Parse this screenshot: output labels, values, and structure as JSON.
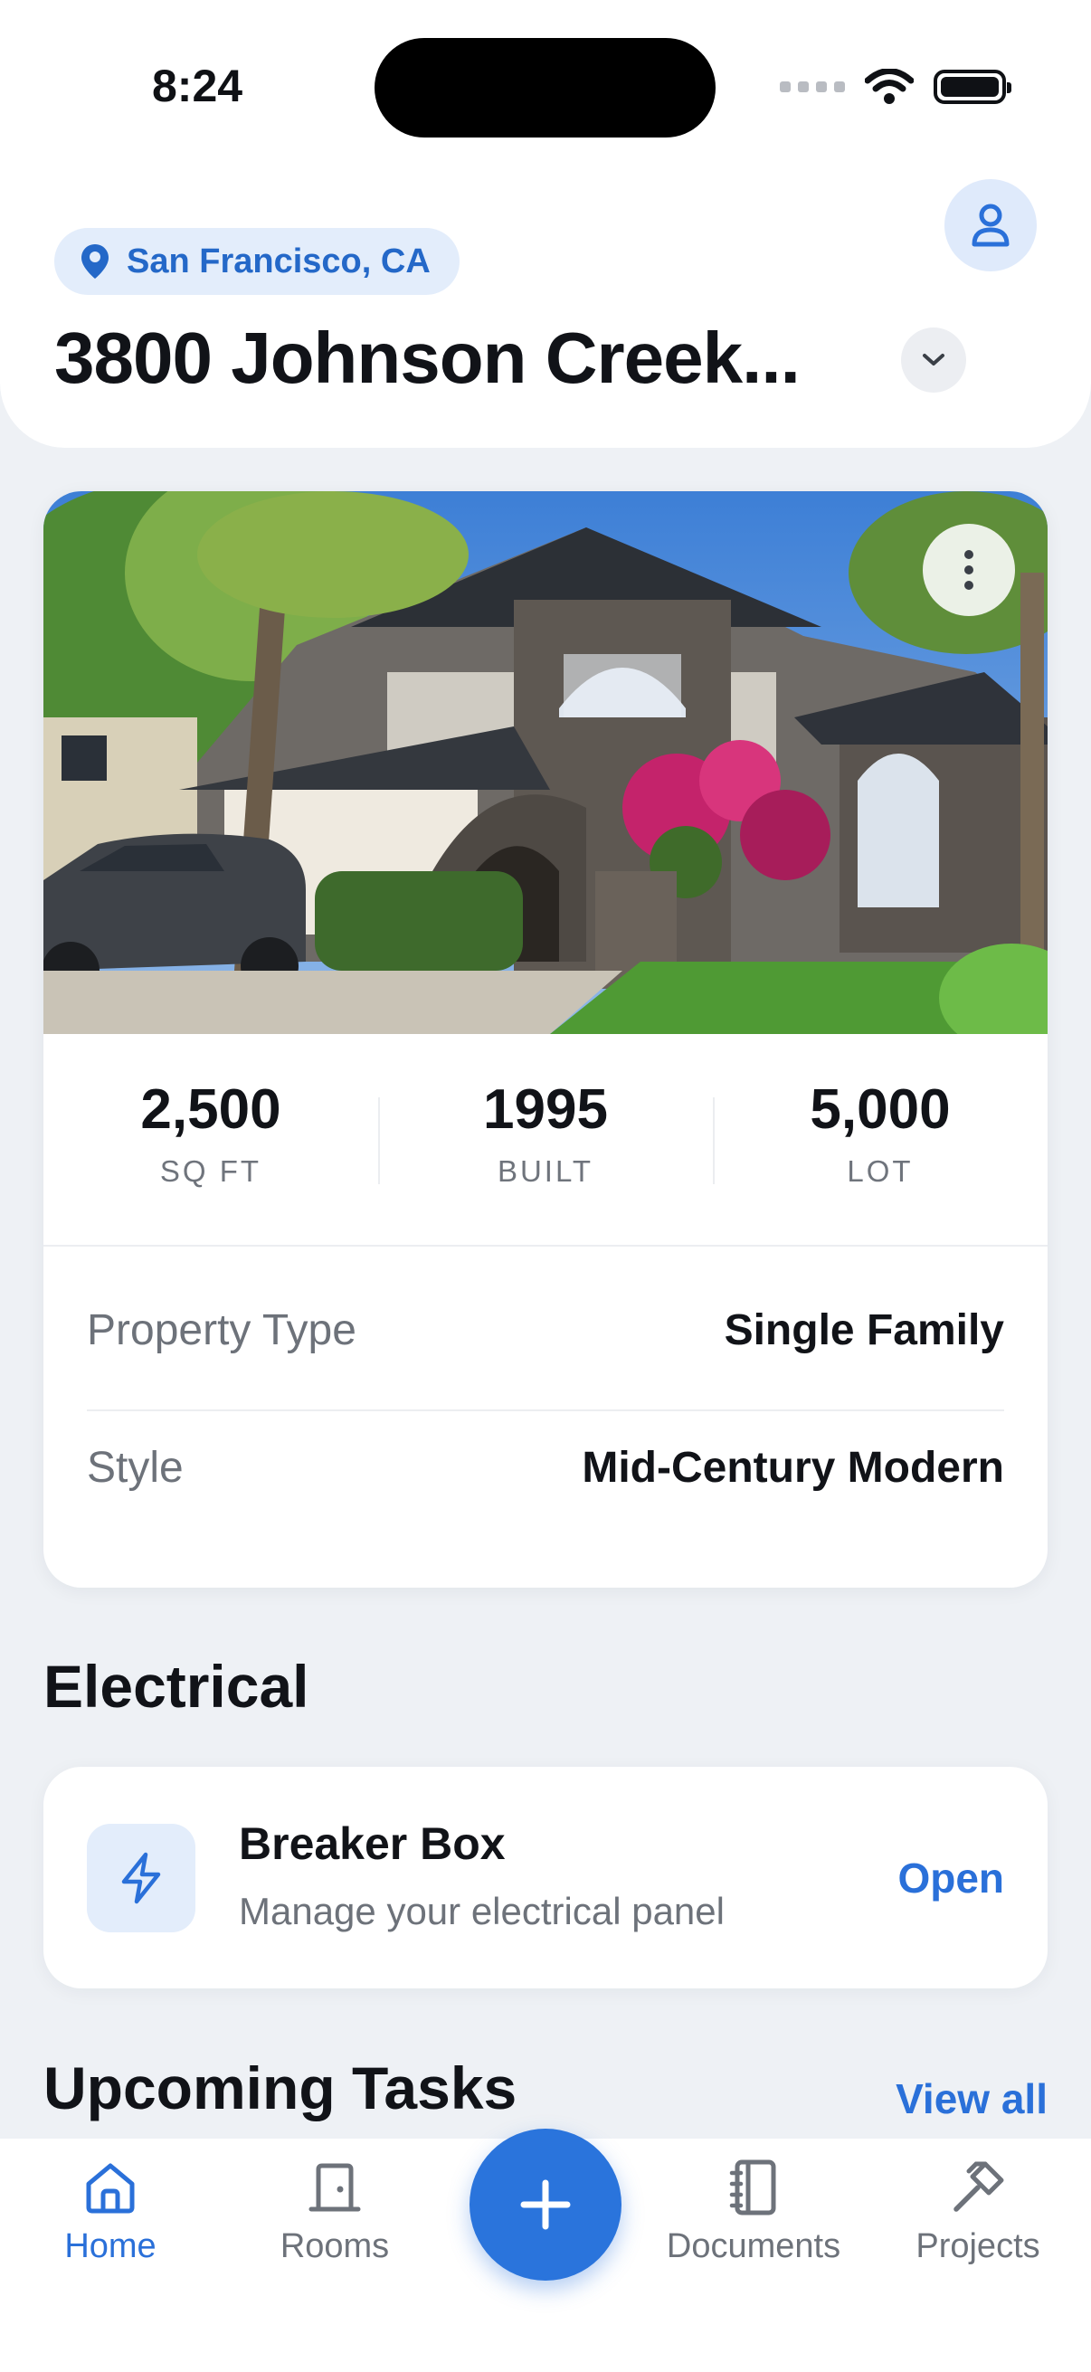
{
  "status_bar": {
    "time": "8:24"
  },
  "header": {
    "location": "San Francisco, CA",
    "address": "3800 Johnson Creek..."
  },
  "property": {
    "stats": [
      {
        "value": "2,500",
        "label": "SQ FT"
      },
      {
        "value": "1995",
        "label": "BUILT"
      },
      {
        "value": "5,000",
        "label": "LOT"
      }
    ],
    "details": [
      {
        "key": "Property Type",
        "value": "Single Family"
      },
      {
        "key": "Style",
        "value": "Mid-Century Modern"
      }
    ]
  },
  "electrical": {
    "section_title": "Electrical",
    "item_title": "Breaker Box",
    "item_subtitle": "Manage your electrical panel",
    "action": "Open"
  },
  "tasks": {
    "section_title": "Upcoming Tasks",
    "view_all": "View all"
  },
  "tabbar": {
    "tabs": [
      {
        "label": "Home",
        "icon": "home-icon",
        "active": true
      },
      {
        "label": "Rooms",
        "icon": "door-icon",
        "active": false
      },
      {
        "label": "Documents",
        "icon": "notebook-icon",
        "active": false
      },
      {
        "label": "Projects",
        "icon": "hammer-icon",
        "active": false
      }
    ],
    "fab_icon": "plus-icon"
  },
  "colors": {
    "accent": "#2a70d9",
    "background": "#eef1f5",
    "chip": "#e3edfb"
  }
}
